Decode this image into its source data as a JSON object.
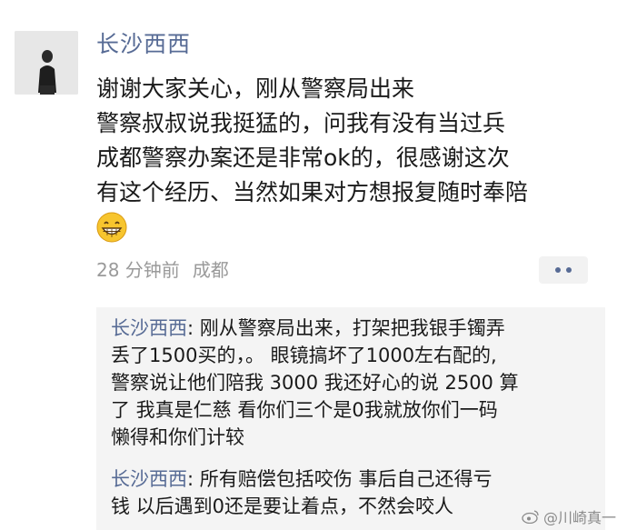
{
  "post": {
    "author": "长沙西西",
    "lines": [
      "谢谢大家关心，刚从警察局出来",
      "警察叔叔说我挺猛的，问我有没有当过兵",
      "成都警察办案还是非常ok的，很感谢这次",
      "有这个经历、当然如果对方想报复随时奉陪"
    ],
    "emoji": "grinning-face",
    "time": "28 分钟前",
    "location": "成都"
  },
  "comments": [
    {
      "author": "长沙西西",
      "first_line": "刚从警察局出来，打架把我银手镯弄",
      "lines": [
        "丢了1500买的，。 眼镜搞坏了1000左右配的,",
        "警察说让他们陪我 3000 我还好心的说 2500 算",
        "了 我真是仁慈 看你们三个是0我就放你们一码",
        "懒得和你们计较"
      ]
    },
    {
      "author": "长沙西西",
      "first_line": "所有赔偿包括咬伤 事后自己还得亏",
      "lines": [
        "钱 以后遇到0还是要让着点，不然会咬人"
      ]
    }
  ],
  "watermark": "@川崎真一",
  "colors": {
    "link": "#576b95",
    "meta": "#9a9a9a",
    "comment_bg": "#f4f4f4"
  }
}
